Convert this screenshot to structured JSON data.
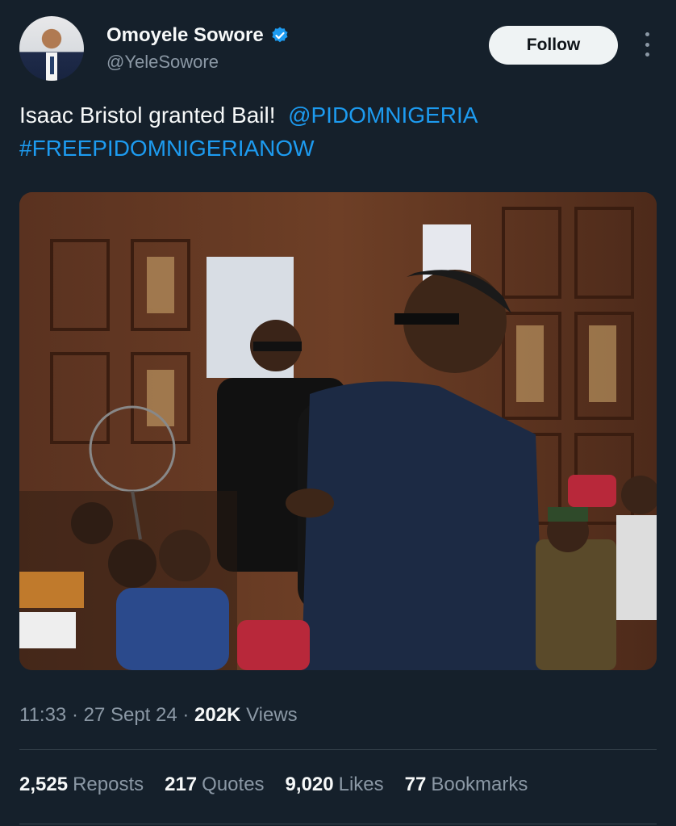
{
  "author": {
    "display_name": "Omoyele Sowore",
    "handle": "@YeleSowore",
    "verified_icon": "verified-badge-icon"
  },
  "follow_label": "Follow",
  "tweet": {
    "text_plain": "Isaac Bristol granted Bail!",
    "mention": "@PIDOMNIGERIA",
    "hashtag": "#FREEPIDOMNIGERIANOW"
  },
  "meta": {
    "time": "11:33",
    "date": "27 Sept 24",
    "views_count": "202K",
    "views_label": "Views"
  },
  "stats": {
    "reposts_count": "2,525",
    "reposts_label": "Reposts",
    "quotes_count": "217",
    "quotes_label": "Quotes",
    "likes_count": "9,020",
    "likes_label": "Likes",
    "bookmarks_count": "77",
    "bookmarks_label": "Bookmarks"
  },
  "colors": {
    "background": "#15202b",
    "link": "#1d9bf0",
    "secondary_text": "#8b98a5"
  }
}
